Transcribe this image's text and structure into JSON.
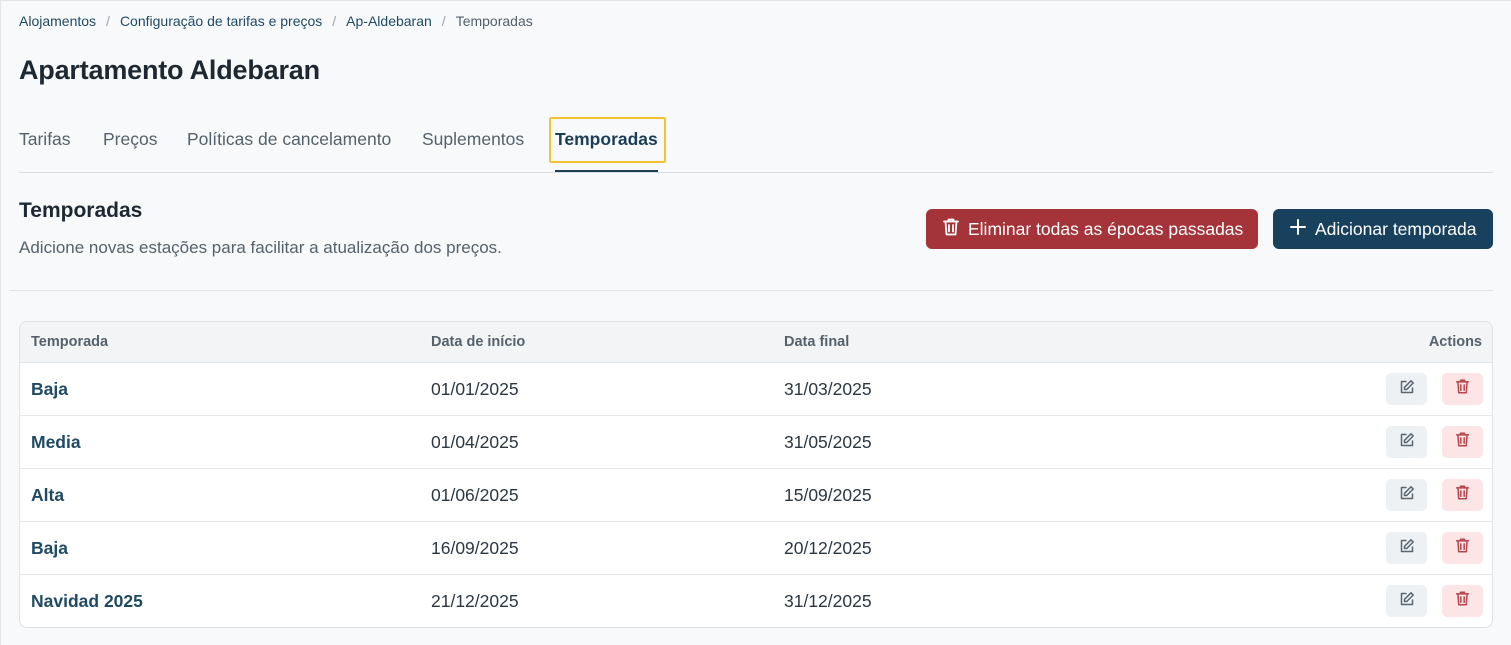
{
  "breadcrumb": {
    "items": [
      "Alojamentos",
      "Configuração de tarifas e preços",
      "Ap-Aldebaran",
      "Temporadas"
    ]
  },
  "page_title": "Apartamento Aldebaran",
  "tabs": [
    {
      "label": "Tarifas"
    },
    {
      "label": "Preços"
    },
    {
      "label": "Políticas de cancelamento"
    },
    {
      "label": "Suplementos"
    },
    {
      "label": "Temporadas",
      "active": true
    }
  ],
  "section": {
    "title": "Temporadas",
    "description": "Adicione novas estações para facilitar a atualização dos preços."
  },
  "buttons": {
    "delete_past": "Eliminar todas as épocas passadas",
    "add": "Adicionar temporada"
  },
  "table": {
    "headers": [
      "Temporada",
      "Data de início",
      "Data final",
      "Actions"
    ],
    "rows": [
      {
        "name": "Baja",
        "start": "01/01/2025",
        "end": "31/03/2025"
      },
      {
        "name": "Media",
        "start": "01/04/2025",
        "end": "31/05/2025"
      },
      {
        "name": "Alta",
        "start": "01/06/2025",
        "end": "15/09/2025"
      },
      {
        "name": "Baja",
        "start": "16/09/2025",
        "end": "20/12/2025"
      },
      {
        "name": "Navidad 2025",
        "start": "21/12/2025",
        "end": "31/12/2025"
      }
    ]
  },
  "icons": {
    "delete_past": "trash-icon",
    "add": "plus-icon",
    "edit": "edit-icon",
    "delete": "trash-icon"
  },
  "colors": {
    "primary": "#17415d",
    "danger": "#a4343a",
    "focus": "#f2c230"
  }
}
